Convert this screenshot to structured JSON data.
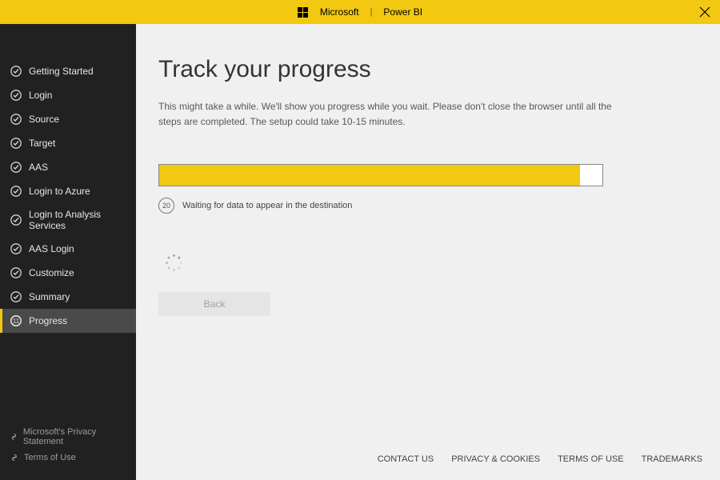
{
  "brand": {
    "company": "Microsoft",
    "product": "Power BI"
  },
  "sidebar": {
    "items": [
      {
        "label": "Getting Started",
        "status": "done"
      },
      {
        "label": "Login",
        "status": "done"
      },
      {
        "label": "Source",
        "status": "done"
      },
      {
        "label": "Target",
        "status": "done"
      },
      {
        "label": "AAS",
        "status": "done"
      },
      {
        "label": "Login to Azure",
        "status": "done"
      },
      {
        "label": "Login to Analysis Services",
        "status": "done"
      },
      {
        "label": "AAS Login",
        "status": "done"
      },
      {
        "label": "Customize",
        "status": "done"
      },
      {
        "label": "Summary",
        "status": "done"
      },
      {
        "label": "Progress",
        "status": "active",
        "step": "11"
      }
    ],
    "footer": {
      "privacy": "Microsoft's Privacy Statement",
      "terms": "Terms of Use"
    }
  },
  "main": {
    "title": "Track your progress",
    "description": "This might take a while. We'll show you progress while you wait. Please don't close the browser until all the steps are completed. The setup could take 10-15 minutes.",
    "progress_percent": 95,
    "status_step": "20",
    "status_text": "Waiting for data to appear in the destination",
    "back_label": "Back"
  },
  "footerLinks": {
    "contact": "CONTACT US",
    "privacy": "PRIVACY & COOKIES",
    "terms": "TERMS OF USE",
    "trademarks": "TRADEMARKS"
  },
  "colors": {
    "accent": "#f2c811"
  }
}
